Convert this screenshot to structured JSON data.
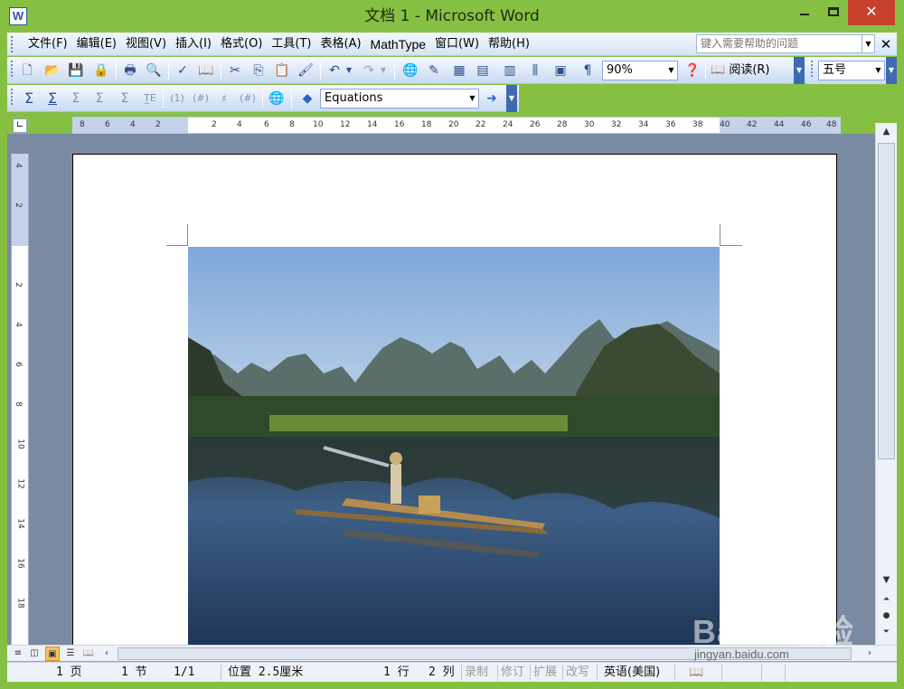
{
  "window": {
    "title": "文档 1 - Microsoft Word",
    "app_icon": "word-doc-icon",
    "controls": {
      "minimize": "minimize-icon",
      "maximize": "maximize-icon",
      "close": "✕"
    }
  },
  "menubar": {
    "items": [
      "文件(F)",
      "编辑(E)",
      "视图(V)",
      "插入(I)",
      "格式(O)",
      "工具(T)",
      "表格(A)",
      "MathType",
      "窗口(W)",
      "帮助(H)"
    ],
    "help_placeholder": "键入需要帮助的问题",
    "close_label": "✕"
  },
  "toolbar_standard": {
    "zoom": "90%",
    "reading_label": "阅读(R)",
    "font_size": "五号"
  },
  "toolbar_math": {
    "equations_combo": "Equations"
  },
  "ruler": {
    "h_labels": [
      "8",
      "6",
      "4",
      "2",
      "2",
      "4",
      "6",
      "8",
      "10",
      "12",
      "14",
      "16",
      "18",
      "20",
      "22",
      "24",
      "26",
      "28",
      "30",
      "32",
      "34",
      "36",
      "38",
      "40",
      "42",
      "44",
      "46",
      "48"
    ],
    "v_labels": [
      "4",
      "2",
      "2",
      "4",
      "6",
      "8",
      "10",
      "12",
      "14",
      "16",
      "18"
    ]
  },
  "statusbar": {
    "page": "1 页",
    "section": "1 节",
    "page_of": "1/1",
    "position": "位置 2.5厘米",
    "line": "1 行",
    "column": "2 列",
    "rec": "录制",
    "trk": "修订",
    "ext": "扩展",
    "ovr": "改写",
    "language": "英语(美国)"
  },
  "watermark": {
    "logo": "Baidu经验",
    "url": "jingyan.baidu.com"
  },
  "colors": {
    "frame": "#86c043",
    "close_button": "#c7412d",
    "toolbar_accent": "#3f6ab3",
    "workspace": "#7b8aa3"
  }
}
